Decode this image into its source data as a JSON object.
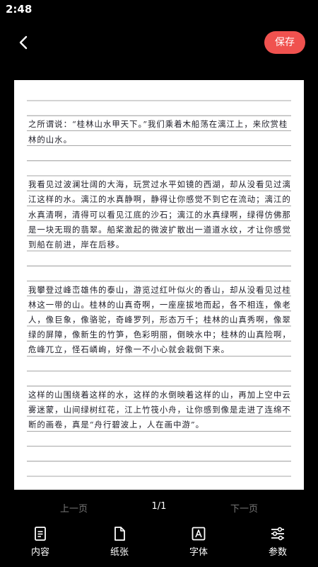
{
  "status": {
    "time": "2:48"
  },
  "topbar": {
    "save_label": "保存"
  },
  "paper": {
    "lines": [
      "之所谓说：“桂林山水甲天下。”我们乘着木船荡在漓江上，来欣赏桂林的山水。",
      "我看见过波澜壮阔的大海，玩赏过水平如镜的西湖，却从没看见过漓江这样的水。漓江的水真静啊，静得让你感觉不到它在流动；漓江的水真清啊，清得可以看见江底的沙石；漓江的水真绿啊，绿得仿佛那是一块无瑕的翡翠。船桨激起的微波扩散出一道道水纹，才让你感觉到船在前进，岸在后移。",
      "我攀登过峰峦雄伟的泰山，游览过红叶似火的香山，却从没看见过桂林这一带的山。桂林的山真奇啊，一座座拔地而起，各不相连，像老人，像巨象，像骆驼，奇峰罗列，形态万千；桂林的山真秀啊，像翠绿的屏障，像新生的竹笋，色彩明丽，倒映水中；桂林的山真险啊，危峰兀立，怪石嶙峋，好像一不小心就会栽倒下来。",
      "这样的山围绕着这样的水，这样的水倒映着这样的山，再加上空中云雾迷蒙，山间绿树红花，江上竹筏小舟，让你感到像是走进了连绵不断的画卷，真是“舟行碧波上，人在画中游”。"
    ]
  },
  "pager": {
    "prev": "上一页",
    "page": "1/1",
    "next": "下一页"
  },
  "nav": {
    "content": "内容",
    "paper": "纸张",
    "font": "字体",
    "params": "参数"
  }
}
